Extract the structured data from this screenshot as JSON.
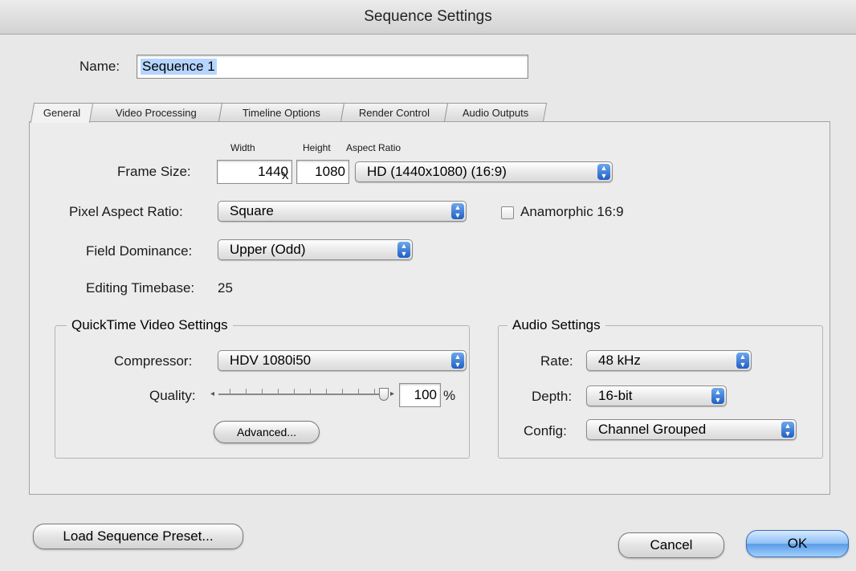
{
  "dialog": {
    "title": "Sequence Settings"
  },
  "name": {
    "label": "Name:",
    "value": "Sequence 1"
  },
  "tabs": [
    {
      "label": "General"
    },
    {
      "label": "Video Processing"
    },
    {
      "label": "Timeline Options"
    },
    {
      "label": "Render Control"
    },
    {
      "label": "Audio Outputs"
    }
  ],
  "general": {
    "frame_size": {
      "label": "Frame Size:",
      "width_header": "Width",
      "height_header": "Height",
      "aspect_header": "Aspect Ratio",
      "width": "1440",
      "separator": "x",
      "height": "1080",
      "aspect": "HD (1440x1080) (16:9)"
    },
    "pixel_aspect": {
      "label": "Pixel Aspect Ratio:",
      "value": "Square"
    },
    "anamorphic": {
      "label": "Anamorphic 16:9",
      "checked": false
    },
    "field_dominance": {
      "label": "Field Dominance:",
      "value": "Upper (Odd)"
    },
    "editing_timebase": {
      "label": "Editing Timebase:",
      "value": "25"
    },
    "quicktime": {
      "title": "QuickTime Video Settings",
      "compressor_label": "Compressor:",
      "compressor": "HDV 1080i50",
      "quality_label": "Quality:",
      "quality": "100",
      "quality_unit": "%",
      "advanced_label": "Advanced..."
    },
    "audio": {
      "title": "Audio Settings",
      "rate_label": "Rate:",
      "rate": "48 kHz",
      "depth_label": "Depth:",
      "depth": "16-bit",
      "config_label": "Config:",
      "config": "Channel Grouped"
    }
  },
  "footer": {
    "load_preset": "Load Sequence Preset...",
    "cancel": "Cancel",
    "ok": "OK"
  }
}
